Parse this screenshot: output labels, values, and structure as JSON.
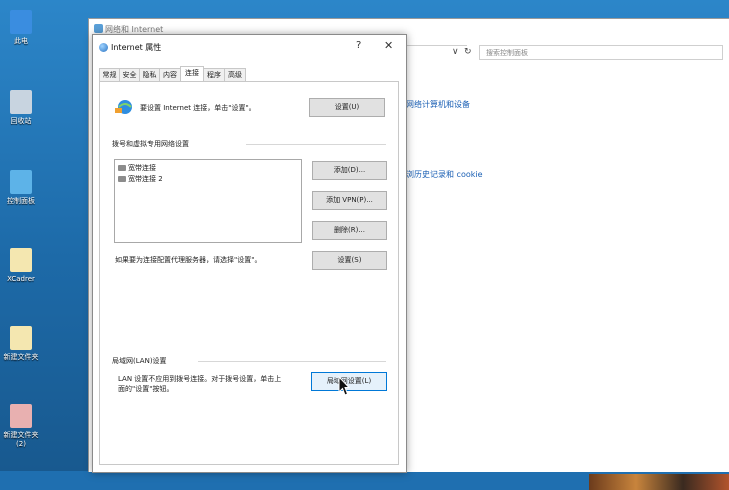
{
  "desktop": {
    "icons": [
      {
        "label": "此电",
        "color": "#3a8de0"
      },
      {
        "label": "回收站",
        "color": "#c8d4e0"
      },
      {
        "label": "控制面板",
        "color": "#5db3e8"
      },
      {
        "label": "XCadrer",
        "color": "#f4e7b0"
      },
      {
        "label": "新建文件夹",
        "color": "#f4e7b0"
      },
      {
        "label": "新建文件夹",
        "label2": "(2)",
        "color": "#e8b0b0"
      }
    ]
  },
  "control_panel": {
    "title": "网络和 Internet",
    "search_placeholder": "搜索控制面板",
    "dropdown_glyph": "∨",
    "refresh_glyph": "↻",
    "links": [
      "网络计算机和设备",
      "浏历史记录和 cookie"
    ]
  },
  "dialog": {
    "title": "Internet 属性",
    "help": "?",
    "close": "✕",
    "tabs": [
      "常规",
      "安全",
      "隐私",
      "内容",
      "连接",
      "程序",
      "高级"
    ],
    "active_tab": "连接",
    "setup_text": "要设置 Internet 连接，单击\"设置\"。",
    "setup_button": "设置(U)",
    "dialup_section": "拨号和虚拟专用网络设置",
    "connections": [
      "宽带连接",
      "宽带连接 2"
    ],
    "add_button": "添加(D)...",
    "add_vpn_button": "添加 VPN(P)...",
    "remove_button": "删除(R)...",
    "proxy_text": "如果要为连接配置代理服务器，请选择\"设置\"。",
    "settings_button": "设置(S)",
    "lan_section": "局域网(LAN)设置",
    "lan_text_line1": "LAN 设置不应用到拨号连接。对于拨号设置，单击上",
    "lan_text_line2": "面的\"设置\"按钮。",
    "lan_button": "局域网设置(L)"
  }
}
